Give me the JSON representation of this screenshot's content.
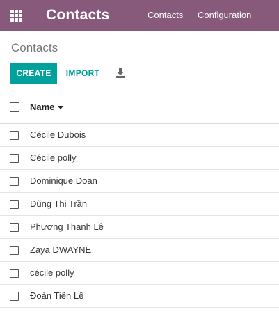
{
  "navbar": {
    "app_title": "Contacts",
    "menu": [
      "Contacts",
      "Configuration"
    ],
    "color": "#875a7b"
  },
  "control_panel": {
    "breadcrumb": "Contacts",
    "create_label": "CREATE",
    "import_label": "IMPORT",
    "download_icon": "download-icon",
    "accent_color": "#00a09d"
  },
  "list": {
    "column": "Name",
    "sort": "descending",
    "rows": [
      "Cécile Dubois",
      "Cécile polly",
      "Dominique Doan",
      "Dũng Thị Trần",
      "Phương Thanh Lê",
      "Zaya DWAYNE",
      "cécile polly",
      "Đoàn Tiến Lê"
    ]
  }
}
